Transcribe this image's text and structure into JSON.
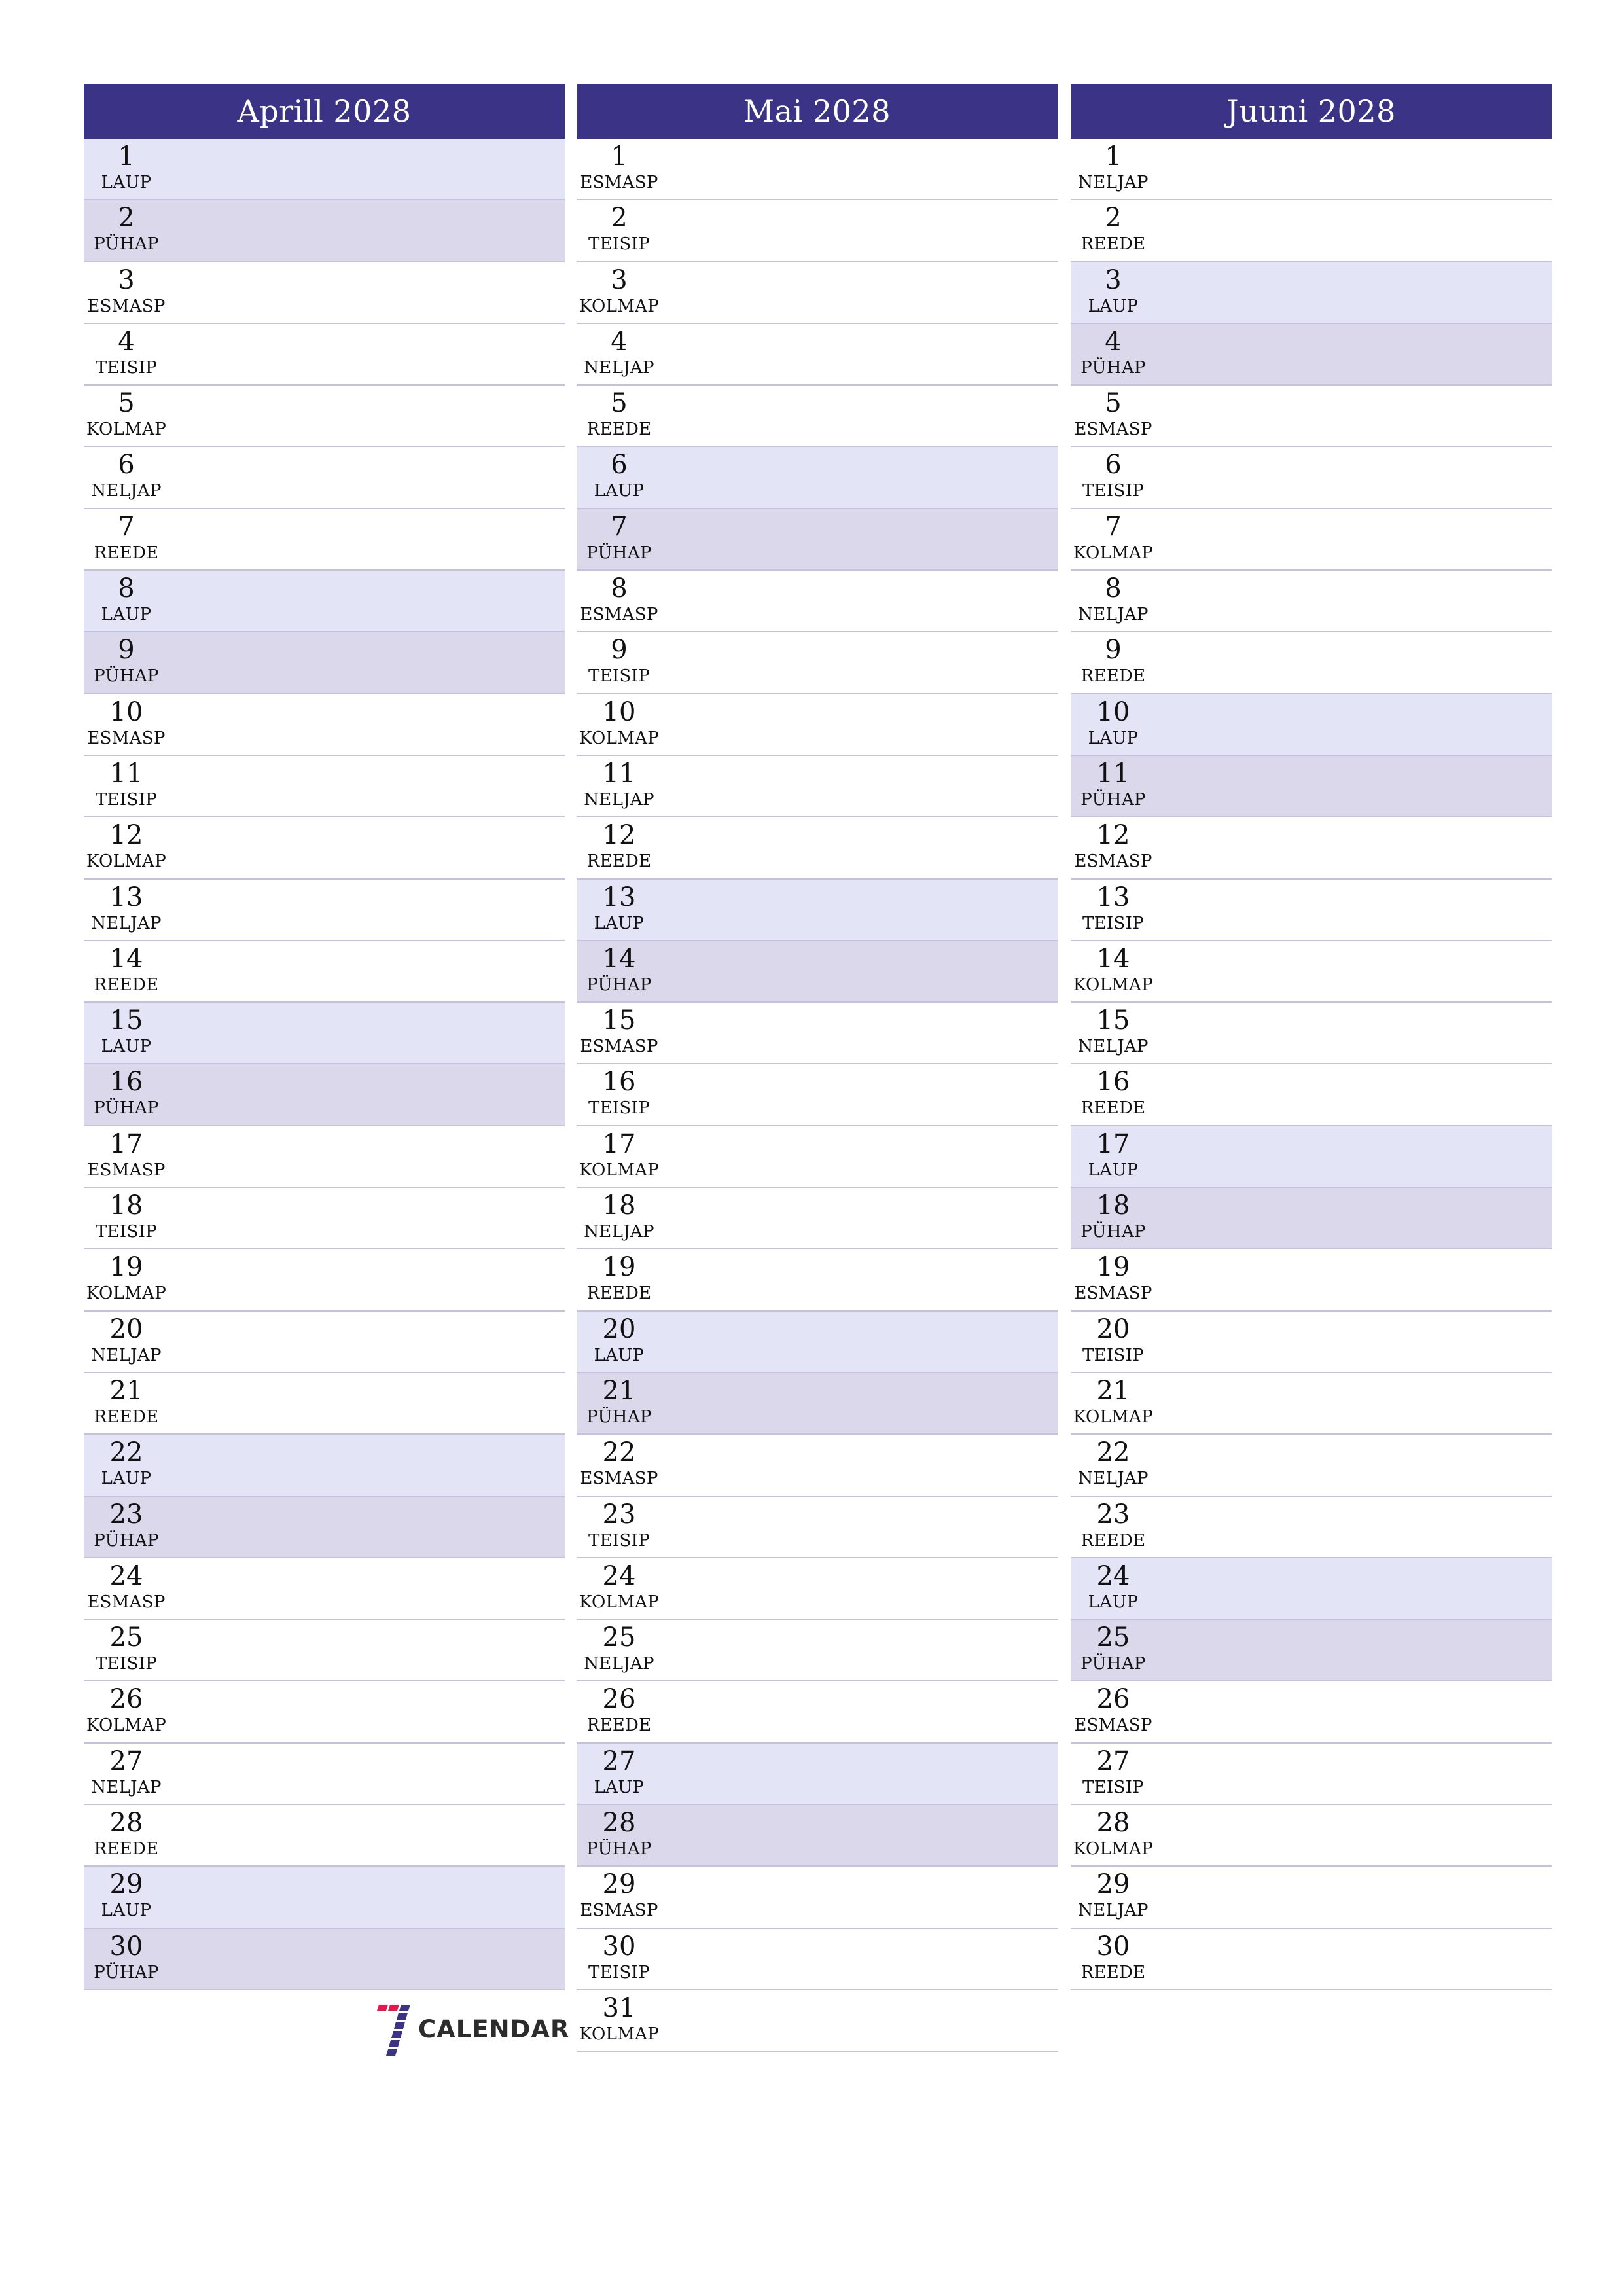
{
  "colors": {
    "header_bg": "#3b3385",
    "header_text": "#ffffff",
    "saturday_bg": "#e4e4f7",
    "sunday_bg": "#dcd8ec",
    "separator": "#c6c2de",
    "logo_red": "#e8174a",
    "logo_blue": "#3b3385"
  },
  "months": [
    {
      "title": "Aprill 2028",
      "days": [
        {
          "n": "1",
          "wd": "LAUP"
        },
        {
          "n": "2",
          "wd": "PÜHAP"
        },
        {
          "n": "3",
          "wd": "ESMASP"
        },
        {
          "n": "4",
          "wd": "TEISIP"
        },
        {
          "n": "5",
          "wd": "KOLMAP"
        },
        {
          "n": "6",
          "wd": "NELJAP"
        },
        {
          "n": "7",
          "wd": "REEDE"
        },
        {
          "n": "8",
          "wd": "LAUP"
        },
        {
          "n": "9",
          "wd": "PÜHAP"
        },
        {
          "n": "10",
          "wd": "ESMASP"
        },
        {
          "n": "11",
          "wd": "TEISIP"
        },
        {
          "n": "12",
          "wd": "KOLMAP"
        },
        {
          "n": "13",
          "wd": "NELJAP"
        },
        {
          "n": "14",
          "wd": "REEDE"
        },
        {
          "n": "15",
          "wd": "LAUP"
        },
        {
          "n": "16",
          "wd": "PÜHAP"
        },
        {
          "n": "17",
          "wd": "ESMASP"
        },
        {
          "n": "18",
          "wd": "TEISIP"
        },
        {
          "n": "19",
          "wd": "KOLMAP"
        },
        {
          "n": "20",
          "wd": "NELJAP"
        },
        {
          "n": "21",
          "wd": "REEDE"
        },
        {
          "n": "22",
          "wd": "LAUP"
        },
        {
          "n": "23",
          "wd": "PÜHAP"
        },
        {
          "n": "24",
          "wd": "ESMASP"
        },
        {
          "n": "25",
          "wd": "TEISIP"
        },
        {
          "n": "26",
          "wd": "KOLMAP"
        },
        {
          "n": "27",
          "wd": "NELJAP"
        },
        {
          "n": "28",
          "wd": "REEDE"
        },
        {
          "n": "29",
          "wd": "LAUP"
        },
        {
          "n": "30",
          "wd": "PÜHAP"
        }
      ]
    },
    {
      "title": "Mai 2028",
      "days": [
        {
          "n": "1",
          "wd": "ESMASP"
        },
        {
          "n": "2",
          "wd": "TEISIP"
        },
        {
          "n": "3",
          "wd": "KOLMAP"
        },
        {
          "n": "4",
          "wd": "NELJAP"
        },
        {
          "n": "5",
          "wd": "REEDE"
        },
        {
          "n": "6",
          "wd": "LAUP"
        },
        {
          "n": "7",
          "wd": "PÜHAP"
        },
        {
          "n": "8",
          "wd": "ESMASP"
        },
        {
          "n": "9",
          "wd": "TEISIP"
        },
        {
          "n": "10",
          "wd": "KOLMAP"
        },
        {
          "n": "11",
          "wd": "NELJAP"
        },
        {
          "n": "12",
          "wd": "REEDE"
        },
        {
          "n": "13",
          "wd": "LAUP"
        },
        {
          "n": "14",
          "wd": "PÜHAP"
        },
        {
          "n": "15",
          "wd": "ESMASP"
        },
        {
          "n": "16",
          "wd": "TEISIP"
        },
        {
          "n": "17",
          "wd": "KOLMAP"
        },
        {
          "n": "18",
          "wd": "NELJAP"
        },
        {
          "n": "19",
          "wd": "REEDE"
        },
        {
          "n": "20",
          "wd": "LAUP"
        },
        {
          "n": "21",
          "wd": "PÜHAP"
        },
        {
          "n": "22",
          "wd": "ESMASP"
        },
        {
          "n": "23",
          "wd": "TEISIP"
        },
        {
          "n": "24",
          "wd": "KOLMAP"
        },
        {
          "n": "25",
          "wd": "NELJAP"
        },
        {
          "n": "26",
          "wd": "REEDE"
        },
        {
          "n": "27",
          "wd": "LAUP"
        },
        {
          "n": "28",
          "wd": "PÜHAP"
        },
        {
          "n": "29",
          "wd": "ESMASP"
        },
        {
          "n": "30",
          "wd": "TEISIP"
        },
        {
          "n": "31",
          "wd": "KOLMAP"
        }
      ]
    },
    {
      "title": "Juuni 2028",
      "days": [
        {
          "n": "1",
          "wd": "NELJAP"
        },
        {
          "n": "2",
          "wd": "REEDE"
        },
        {
          "n": "3",
          "wd": "LAUP"
        },
        {
          "n": "4",
          "wd": "PÜHAP"
        },
        {
          "n": "5",
          "wd": "ESMASP"
        },
        {
          "n": "6",
          "wd": "TEISIP"
        },
        {
          "n": "7",
          "wd": "KOLMAP"
        },
        {
          "n": "8",
          "wd": "NELJAP"
        },
        {
          "n": "9",
          "wd": "REEDE"
        },
        {
          "n": "10",
          "wd": "LAUP"
        },
        {
          "n": "11",
          "wd": "PÜHAP"
        },
        {
          "n": "12",
          "wd": "ESMASP"
        },
        {
          "n": "13",
          "wd": "TEISIP"
        },
        {
          "n": "14",
          "wd": "KOLMAP"
        },
        {
          "n": "15",
          "wd": "NELJAP"
        },
        {
          "n": "16",
          "wd": "REEDE"
        },
        {
          "n": "17",
          "wd": "LAUP"
        },
        {
          "n": "18",
          "wd": "PÜHAP"
        },
        {
          "n": "19",
          "wd": "ESMASP"
        },
        {
          "n": "20",
          "wd": "TEISIP"
        },
        {
          "n": "21",
          "wd": "KOLMAP"
        },
        {
          "n": "22",
          "wd": "NELJAP"
        },
        {
          "n": "23",
          "wd": "REEDE"
        },
        {
          "n": "24",
          "wd": "LAUP"
        },
        {
          "n": "25",
          "wd": "PÜHAP"
        },
        {
          "n": "26",
          "wd": "ESMASP"
        },
        {
          "n": "27",
          "wd": "TEISIP"
        },
        {
          "n": "28",
          "wd": "KOLMAP"
        },
        {
          "n": "29",
          "wd": "NELJAP"
        },
        {
          "n": "30",
          "wd": "REEDE"
        }
      ]
    }
  ],
  "logo": {
    "icon": "seven-logo-icon",
    "text": "CALENDAR"
  }
}
